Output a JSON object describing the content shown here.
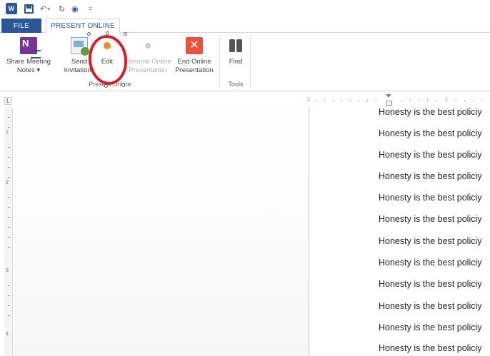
{
  "quick_access": {
    "app_icon": "word-icon",
    "app_letters": "W",
    "undo_glyph": "↶",
    "redo_glyph": "↻",
    "touch_glyph": "◉",
    "customize_glyph": "="
  },
  "tabs": {
    "file_label": "FILE",
    "active_label": "PRESENT ONLINE"
  },
  "ribbon": {
    "buttons": [
      {
        "label_line1": "Share Meeting",
        "label_line2": "Notes ▾",
        "icon": "onenote-icon"
      },
      {
        "label_line1": "Send",
        "label_line2": "Invitations",
        "icon": "send-invitations-icon"
      },
      {
        "label_line1": "Edit",
        "label_line2": "",
        "icon": "edit-dot-icon"
      },
      {
        "label_line1": "Resume Online",
        "label_line2": "Presentation",
        "icon": "resume-dot-icon"
      },
      {
        "label_line1": "End Online",
        "label_line2": "Presentation",
        "icon": "end-presentation-icon"
      },
      {
        "label_line1": "Find",
        "label_line2": "",
        "icon": "binoculars-icon"
      }
    ],
    "groups": {
      "present_online": "Present Online",
      "tools": "Tools"
    }
  },
  "ruler": {
    "corner_glyph": "L",
    "h_numbers": [
      "1",
      "1"
    ],
    "v_numbers": [
      "1",
      "2",
      "3",
      "4"
    ]
  },
  "document": {
    "lines": [
      "Honesty is the best policiy",
      "Honesty is the best policiy",
      "Honesty is the best policiy",
      "Honesty is the best policiy",
      "Honesty is the best policiy",
      "Honesty is the best policiy",
      "Honesty is the best policiy",
      "Honesty is the best policiy",
      "Honesty is the best policiy",
      "Honesty is the best policiy",
      "Honesty is the best policiy",
      "Honesty is the best policiy"
    ]
  },
  "colors": {
    "accent": "#2b579a",
    "annotation": "#d41f2a",
    "edit_dot": "#f08a24"
  }
}
